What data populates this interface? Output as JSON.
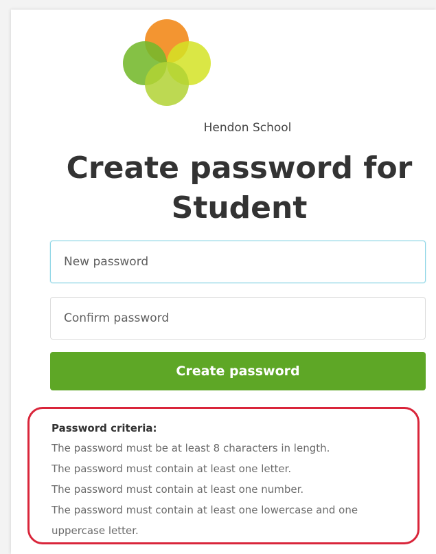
{
  "school": {
    "name": "Hendon School"
  },
  "page": {
    "title_line1": "Create password for",
    "title_line2": "Student"
  },
  "form": {
    "new_password_placeholder": "New password",
    "confirm_password_placeholder": "Confirm password",
    "submit_label": "Create password"
  },
  "criteria": {
    "title": "Password criteria:",
    "items": [
      "The password must be at least 8 characters in length.",
      "The password must contain at least one letter.",
      "The password must contain at least one number.",
      "The password must contain at least one lowercase and one",
      "uppercase letter."
    ]
  },
  "colors": {
    "primary_button": "#5ea726",
    "highlight_border": "#d9253a",
    "focus_border": "#8fd6e6",
    "logo": [
      "#f28c1f",
      "#74b82b",
      "#d4e324",
      "#b2d234"
    ]
  }
}
